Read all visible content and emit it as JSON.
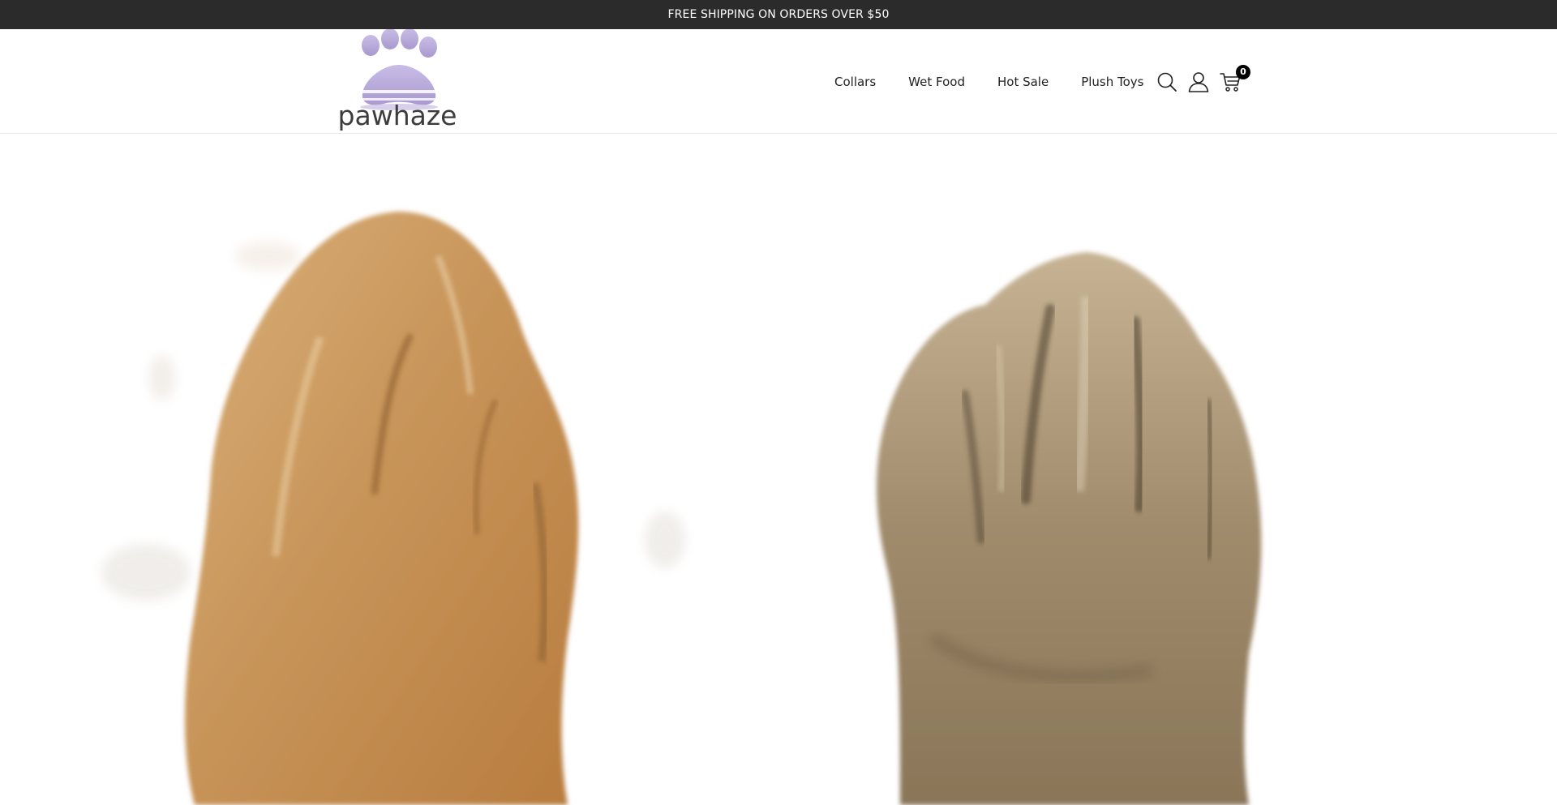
{
  "announcement": {
    "text": "FREE SHIPPING ON ORDERS OVER $50"
  },
  "brand": {
    "name": "pawhaze",
    "logo_icon": "paw-print-icon",
    "accent": "#b4a6d6"
  },
  "nav": {
    "items": [
      {
        "label": "Collars"
      },
      {
        "label": "Wet Food"
      },
      {
        "label": "Hot Sale"
      },
      {
        "label": "Plush Toys"
      }
    ]
  },
  "header_icons": {
    "search": "search-icon",
    "account": "user-icon",
    "cart": "cart-icon",
    "cart_count": "0"
  },
  "hero": {
    "image": "two furry pet paws on white background",
    "left_paw_color": "#c8955a",
    "right_paw_color": "#a08b6c"
  }
}
